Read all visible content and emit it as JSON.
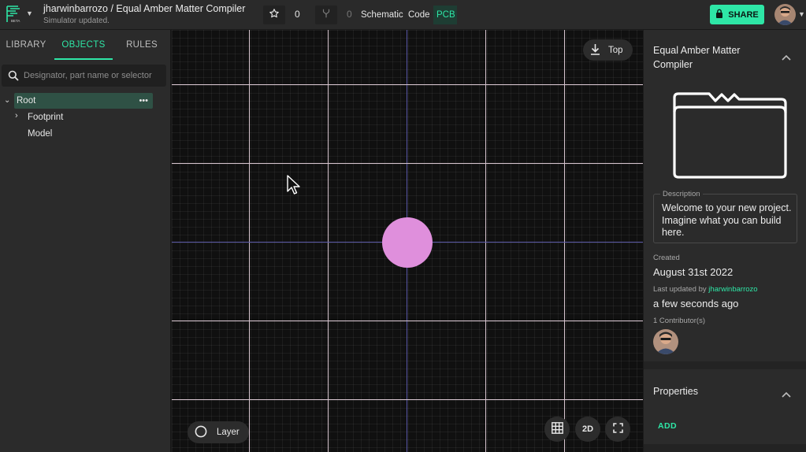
{
  "header": {
    "title": "jharwinbarrozo / Equal Amber Matter Compiler",
    "status": "Simulator updated.",
    "logo_badge": "BETA",
    "star_count": "0",
    "fork_count": "0",
    "tabs": [
      {
        "label": "Schematic",
        "active": false
      },
      {
        "label": "Code",
        "active": false
      },
      {
        "label": "PCB",
        "active": true
      }
    ],
    "share_label": "SHARE",
    "accent_color": "#2ee6a6"
  },
  "left_panel": {
    "tabs": [
      {
        "label": "LIBRARY",
        "active": false
      },
      {
        "label": "OBJECTS",
        "active": true
      },
      {
        "label": "RULES",
        "active": false
      }
    ],
    "search_placeholder": "Designator, part name or selector",
    "tree": [
      {
        "label": "Root",
        "expanded": true,
        "selected": true
      },
      {
        "label": "Footprint",
        "expanded": false
      },
      {
        "label": "Model"
      }
    ]
  },
  "canvas": {
    "view_label": "Top",
    "layer_label": "Layer",
    "mode_label": "2D",
    "pad_color": "#df8fdc"
  },
  "right_panel": {
    "project_name": "Equal Amber Matter Compiler",
    "description_label": "Description",
    "description": "Welcome to your new project. Imagine what you can build here.",
    "created_label": "Created",
    "created_value": "August 31st 2022",
    "updated_label": "Last updated by",
    "updated_by": "jharwinbarrozo",
    "updated_value": "a few seconds ago",
    "contributors_label": "1 Contributor(s)",
    "properties_title": "Properties",
    "add_label": "ADD"
  }
}
